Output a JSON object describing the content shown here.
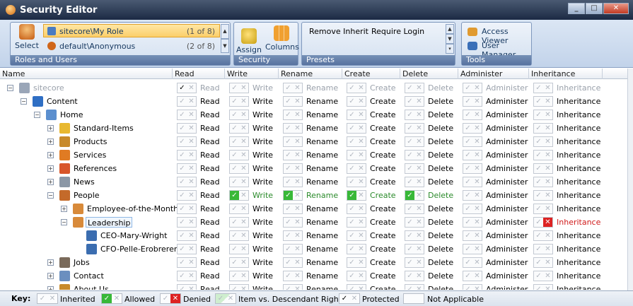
{
  "window": {
    "title": "Security Editor"
  },
  "ribbon": {
    "select_label": "Select",
    "users": [
      {
        "name": "sitecore\\My Role",
        "count": "(1 of 8)"
      },
      {
        "name": "default\\Anonymous",
        "count": "(2 of 8)"
      }
    ],
    "roles_group": "Roles and Users",
    "assign_label": "Assign",
    "columns_label": "Columns",
    "security_group": "Security",
    "presets": [
      "Remove Inherit",
      "Require Login"
    ],
    "presets_group": "Presets",
    "tools": [
      "Access Viewer",
      "User Manager"
    ],
    "tools_group": "Tools"
  },
  "columns": [
    "Name",
    "Read",
    "Write",
    "Rename",
    "Create",
    "Delete",
    "Administer",
    "Inheritance"
  ],
  "rows": [
    {
      "name": "sitecore",
      "icon": "page-icon",
      "color": "#9aa6b8",
      "level": 0,
      "exp": "−",
      "s": [
        "p",
        "n",
        "n",
        "n",
        "n",
        "n",
        "n"
      ],
      "dim": true
    },
    {
      "name": "Content",
      "icon": "content-icon",
      "color": "#2f6fc4",
      "level": 1,
      "exp": "−",
      "s": [
        "n",
        "n",
        "n",
        "n",
        "n",
        "n",
        "n"
      ]
    },
    {
      "name": "Home",
      "icon": "home-icon",
      "color": "#5b8fcf",
      "level": 2,
      "exp": "−",
      "s": [
        "n",
        "n",
        "n",
        "n",
        "n",
        "n",
        "n"
      ]
    },
    {
      "name": "Standard-Items",
      "icon": "folder-icon",
      "color": "#e8b830",
      "level": 3,
      "exp": "+",
      "s": [
        "n",
        "n",
        "n",
        "n",
        "n",
        "n",
        "n"
      ]
    },
    {
      "name": "Products",
      "icon": "products-icon",
      "color": "#c88a2a",
      "level": 3,
      "exp": "+",
      "s": [
        "n",
        "n",
        "n",
        "n",
        "n",
        "n",
        "n"
      ]
    },
    {
      "name": "Services",
      "icon": "services-icon",
      "color": "#e07b23",
      "level": 3,
      "exp": "+",
      "s": [
        "n",
        "n",
        "n",
        "n",
        "n",
        "n",
        "n"
      ]
    },
    {
      "name": "References",
      "icon": "references-icon",
      "color": "#d8562a",
      "level": 3,
      "exp": "+",
      "s": [
        "n",
        "n",
        "n",
        "n",
        "n",
        "n",
        "n"
      ]
    },
    {
      "name": "News",
      "icon": "news-icon",
      "color": "#8b97a6",
      "level": 3,
      "exp": "+",
      "s": [
        "n",
        "n",
        "n",
        "n",
        "n",
        "n",
        "n"
      ]
    },
    {
      "name": "People",
      "icon": "people-icon",
      "color": "#c46a2a",
      "level": 3,
      "exp": "−",
      "s": [
        "n",
        "a",
        "a",
        "a",
        "a",
        "n",
        "n"
      ]
    },
    {
      "name": "Employee-of-the-Month",
      "icon": "employees-icon",
      "color": "#d88a3a",
      "level": 4,
      "exp": "+",
      "s": [
        "n",
        "n",
        "n",
        "n",
        "n",
        "n",
        "n"
      ]
    },
    {
      "name": "Leadership",
      "icon": "employees-icon",
      "color": "#d88a3a",
      "level": 4,
      "exp": "−",
      "s": [
        "n",
        "n",
        "n",
        "n",
        "n",
        "n",
        "d"
      ],
      "selected": true
    },
    {
      "name": "CEO-Mary-Wright",
      "icon": "person-icon",
      "color": "#3b6db0",
      "level": 5,
      "exp": "",
      "s": [
        "n",
        "n",
        "n",
        "n",
        "n",
        "n",
        "n"
      ]
    },
    {
      "name": "CFO-Pelle-Erobreren",
      "icon": "person-icon",
      "color": "#3b6db0",
      "level": 5,
      "exp": "",
      "s": [
        "n",
        "n",
        "n",
        "n",
        "n",
        "n",
        "n"
      ]
    },
    {
      "name": "Jobs",
      "icon": "jobs-icon",
      "color": "#7a6a5a",
      "level": 3,
      "exp": "+",
      "s": [
        "n",
        "n",
        "n",
        "n",
        "n",
        "n",
        "n"
      ]
    },
    {
      "name": "Contact",
      "icon": "contact-icon",
      "color": "#6b8fbf",
      "level": 3,
      "exp": "+",
      "s": [
        "n",
        "n",
        "n",
        "n",
        "n",
        "n",
        "n"
      ]
    },
    {
      "name": "About Us",
      "icon": "about-icon",
      "color": "#c88a2a",
      "level": 3,
      "exp": "+",
      "s": [
        "n",
        "n",
        "n",
        "n",
        "n",
        "n",
        "n"
      ]
    }
  ],
  "key": {
    "title": "Key:",
    "inherited": "Inherited",
    "allowed": "Allowed",
    "denied": "Denied",
    "item_vs_desc": "Item vs. Descendant Right",
    "protected": "Protected",
    "na": "Not Applicable"
  },
  "glyphs": {
    "check": "✓",
    "cross": "✕"
  }
}
